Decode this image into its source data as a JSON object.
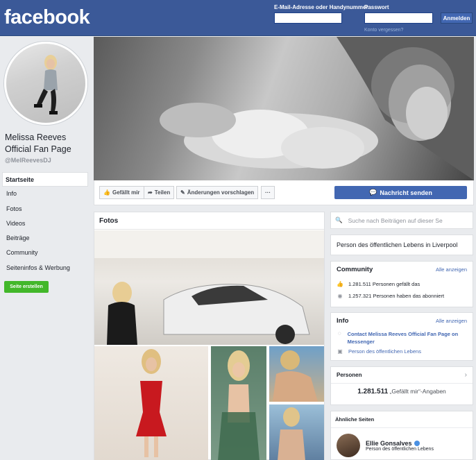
{
  "header": {
    "logo": "facebook",
    "email_label": "E-Mail-Adresse oder Handynummer",
    "password_label": "Passwort",
    "login_button": "Anmelden",
    "forgot_link": "Konto vergessen?"
  },
  "page": {
    "name": "Melissa Reeves Official Fan Page",
    "handle": "@MelReevesDJ"
  },
  "nav": {
    "items": [
      {
        "label": "Startseite"
      },
      {
        "label": "Info"
      },
      {
        "label": "Fotos"
      },
      {
        "label": "Videos"
      },
      {
        "label": "Beiträge"
      },
      {
        "label": "Community"
      },
      {
        "label": "Seiteninfos & Werbung"
      }
    ],
    "create_page": "Seite erstellen"
  },
  "actions": {
    "like": "Gefällt mir",
    "share": "Teilen",
    "suggest": "Änderungen vorschlagen",
    "more": "···",
    "message": "Nachricht senden"
  },
  "photos": {
    "title": "Fotos"
  },
  "sidebar": {
    "search_placeholder": "Suche nach Beiträgen auf dieser Se",
    "category": "Person des öffentlichen Lebens in Liverpool",
    "community": {
      "title": "Community",
      "see_all": "Alle anzeigen",
      "likes": "1.281.511 Personen gefällt das",
      "followers": "1.257.321 Personen haben das abonniert"
    },
    "info": {
      "title": "Info",
      "see_all": "Alle anzeigen",
      "contact": "Contact Melissa Reeves Official Fan Page on Messenger",
      "type": "Person des öffentlichen Lebens"
    },
    "people": {
      "title": "Personen",
      "count": "1.281.511",
      "count_suffix": "„Gefällt mir“-Angaben"
    },
    "similar": {
      "title": "Ähnliche Seiten",
      "page_name": "Ellie Gonsalves",
      "page_type": "Person des öffentlichen Lebens"
    }
  },
  "colors": {
    "brand": "#3b5998",
    "button": "#4267b2",
    "create": "#42b72a"
  }
}
